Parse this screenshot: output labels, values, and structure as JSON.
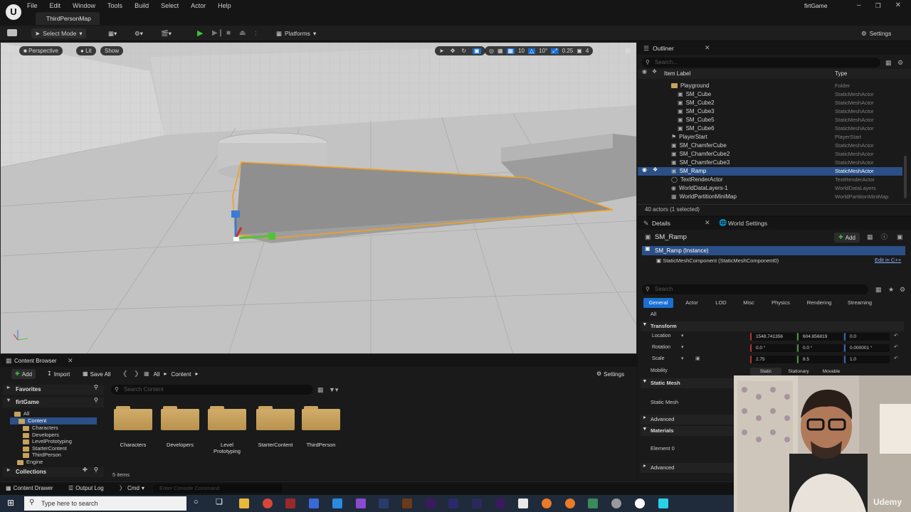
{
  "app": {
    "logo": "U",
    "project_name": "firtGame",
    "map_tab": "ThirdPersonMap"
  },
  "menu": [
    "File",
    "Edit",
    "Window",
    "Tools",
    "Build",
    "Select",
    "Actor",
    "Help"
  ],
  "window_controls": [
    "minimize-icon",
    "restore-icon",
    "close-icon"
  ],
  "toolbar": {
    "select_mode": "Select Mode",
    "platforms": "Platforms",
    "settings": "Settings"
  },
  "viewport": {
    "perspective": "Perspective",
    "lit": "Lit",
    "show": "Show",
    "grid_snap": "10",
    "rot_snap": "10°",
    "scale_snap": "0.25",
    "camera_speed": "4"
  },
  "outliner": {
    "tab": "Outliner",
    "search_placeholder": "Search...",
    "col_label": "Item Label",
    "col_type": "Type",
    "rows": [
      {
        "label": "Playground",
        "type": "Folder",
        "indent": 3,
        "icon": "folder-icon"
      },
      {
        "label": "SM_Cube",
        "type": "StaticMeshActor",
        "indent": 4,
        "icon": "cube-icon"
      },
      {
        "label": "SM_Cube2",
        "type": "StaticMeshActor",
        "indent": 4,
        "icon": "cube-icon"
      },
      {
        "label": "SM_Cube3",
        "type": "StaticMeshActor",
        "indent": 4,
        "icon": "cube-icon"
      },
      {
        "label": "SM_Cube5",
        "type": "StaticMeshActor",
        "indent": 4,
        "icon": "cube-icon"
      },
      {
        "label": "SM_Cube6",
        "type": "StaticMeshActor",
        "indent": 4,
        "icon": "cube-icon"
      },
      {
        "label": "PlayerStart",
        "type": "PlayerStart",
        "indent": 3,
        "icon": "flag-icon"
      },
      {
        "label": "SM_ChamferCube",
        "type": "StaticMeshActor",
        "indent": 3,
        "icon": "cube-icon"
      },
      {
        "label": "SM_ChamferCube2",
        "type": "StaticMeshActor",
        "indent": 3,
        "icon": "cube-icon"
      },
      {
        "label": "SM_ChamferCube3",
        "type": "StaticMeshActor",
        "indent": 3,
        "icon": "cube-icon"
      },
      {
        "label": "SM_Ramp",
        "type": "StaticMeshActor",
        "indent": 3,
        "icon": "cube-icon",
        "selected": true
      },
      {
        "label": "TextRenderActor",
        "type": "TextRenderActor",
        "indent": 3,
        "icon": "text-icon"
      },
      {
        "label": "WorldDataLayers-1",
        "type": "WorldDataLayers",
        "indent": 3,
        "icon": "layers-icon"
      },
      {
        "label": "WorldPartitionMiniMap",
        "type": "WorldPartitionMiniMap",
        "indent": 3,
        "icon": "map-icon"
      }
    ],
    "status": "40 actors (1 selected)"
  },
  "details": {
    "tab": "Details",
    "world_settings_tab": "World Settings",
    "actor_name": "SM_Ramp",
    "add": "Add",
    "instance": "SM_Ramp (Instance)",
    "component": "StaticMeshComponent (StaticMeshComponent0)",
    "edit_cpp": "Edit in C++",
    "search_placeholder": "Search",
    "tabs": [
      "General",
      "Actor",
      "LOD",
      "Misc",
      "Physics",
      "Rendering",
      "Streaming"
    ],
    "all": "All",
    "transform": "Transform",
    "location": {
      "label": "Location",
      "x": "1548.741356",
      "y": "604.856819",
      "z": "0.0"
    },
    "rotation": {
      "label": "Rotation",
      "x": "0.0 °",
      "y": "0.0 °",
      "z": "0.000001 °"
    },
    "scale": {
      "label": "Scale",
      "x": "2.75",
      "y": "8.5",
      "z": "1.0"
    },
    "mobility": {
      "label": "Mobility",
      "options": [
        "Static",
        "Stationary",
        "Movable"
      ]
    },
    "static_mesh_section": "Static Mesh",
    "static_mesh_label": "Static Mesh",
    "advanced": "Advanced",
    "materials": "Materials",
    "element0": "Element 0"
  },
  "content_browser": {
    "tab": "Content Browser",
    "add": "Add",
    "import": "Import",
    "save_all": "Save All",
    "path_all": "All",
    "path_content": "Content",
    "settings": "Settings",
    "favorites": "Favorites",
    "project": "firtGame",
    "search_placeholder": "Search Content",
    "tree": [
      "All",
      "Content",
      "Characters",
      "Developers",
      "LevelPrototyping",
      "StarterContent",
      "ThirdPerson",
      "Engine"
    ],
    "collections": "Collections",
    "folders": [
      "Characters",
      "Developers",
      "Level Prototyping",
      "StarterContent",
      "ThirdPerson"
    ],
    "count": "5 items"
  },
  "statusbar": {
    "content_drawer": "Content Drawer",
    "output_log": "Output Log",
    "cmd": "Cmd",
    "console_placeholder": "Enter Console Command"
  },
  "taskbar": {
    "search_placeholder": "Type here to search"
  },
  "watermark": "Udemy",
  "colors": {
    "selection": "#2b4f86",
    "accent_blue": "#1a6fd1",
    "play_green": "#3fbf3f",
    "outline_orange": "#f2a020"
  }
}
